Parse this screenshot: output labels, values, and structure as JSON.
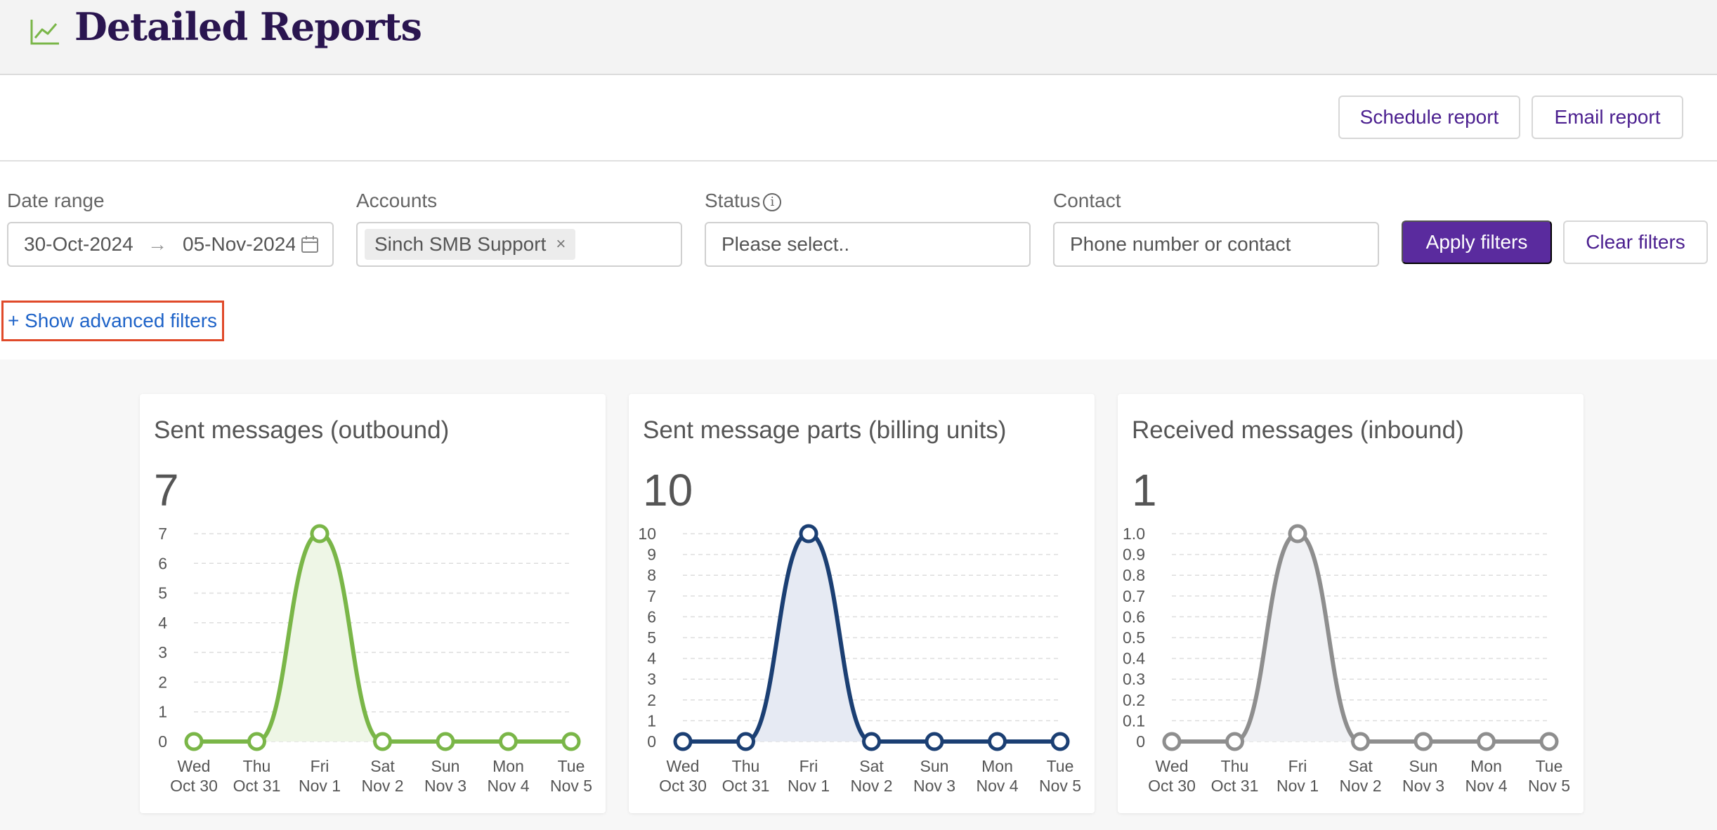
{
  "header": {
    "title": "Detailed Reports",
    "icon": "line-chart-icon",
    "accent": "#7ab648",
    "title_color": "#2a1550"
  },
  "toolbar": {
    "schedule_label": "Schedule report",
    "email_label": "Email report"
  },
  "filters": {
    "date_range": {
      "label": "Date range",
      "start": "30-Oct-2024",
      "end": "05-Nov-2024",
      "separator": "→"
    },
    "accounts": {
      "label": "Accounts",
      "tag": "Sinch SMB Support"
    },
    "status": {
      "label": "Status",
      "placeholder": "Please select.."
    },
    "contact": {
      "label": "Contact",
      "placeholder": "Phone number or contact"
    },
    "apply_label": "Apply filters",
    "clear_label": "Clear filters",
    "advanced_label": "+ Show advanced filters"
  },
  "cards": [
    {
      "title": "Sent messages (outbound)",
      "total": "7",
      "color": "#7ab648",
      "fill": "#eef6e6",
      "chart_data": {
        "type": "area",
        "x": [
          "Wed Oct 30",
          "Thu Oct 31",
          "Fri Nov 1",
          "Sat Nov 2",
          "Sun Nov 3",
          "Mon Nov 4",
          "Tue Nov 5"
        ],
        "x_lines": [
          [
            "Wed",
            "Oct 30"
          ],
          [
            "Thu",
            "Oct 31"
          ],
          [
            "Fri",
            "Nov 1"
          ],
          [
            "Sat",
            "Nov 2"
          ],
          [
            "Sun",
            "Nov 3"
          ],
          [
            "Mon",
            "Nov 4"
          ],
          [
            "Tue",
            "Nov 5"
          ]
        ],
        "values": [
          0,
          0,
          7,
          0,
          0,
          0,
          0
        ],
        "ylim": [
          0,
          7
        ],
        "yticks": [
          "0",
          "1",
          "2",
          "3",
          "4",
          "5",
          "6",
          "7"
        ],
        "grid": true
      }
    },
    {
      "title": "Sent message parts (billing units)",
      "total": "10",
      "color": "#1b3f73",
      "fill": "#e6eaf3",
      "chart_data": {
        "type": "area",
        "x": [
          "Wed Oct 30",
          "Thu Oct 31",
          "Fri Nov 1",
          "Sat Nov 2",
          "Sun Nov 3",
          "Mon Nov 4",
          "Tue Nov 5"
        ],
        "x_lines": [
          [
            "Wed",
            "Oct 30"
          ],
          [
            "Thu",
            "Oct 31"
          ],
          [
            "Fri",
            "Nov 1"
          ],
          [
            "Sat",
            "Nov 2"
          ],
          [
            "Sun",
            "Nov 3"
          ],
          [
            "Mon",
            "Nov 4"
          ],
          [
            "Tue",
            "Nov 5"
          ]
        ],
        "values": [
          0,
          0,
          10,
          0,
          0,
          0,
          0
        ],
        "ylim": [
          0,
          10
        ],
        "yticks": [
          "0",
          "1",
          "2",
          "3",
          "4",
          "5",
          "6",
          "7",
          "8",
          "9",
          "10"
        ],
        "grid": true
      }
    },
    {
      "title": "Received messages (inbound)",
      "total": "1",
      "color": "#8e8e8e",
      "fill": "#f0f1f4",
      "chart_data": {
        "type": "area",
        "x": [
          "Wed Oct 30",
          "Thu Oct 31",
          "Fri Nov 1",
          "Sat Nov 2",
          "Sun Nov 3",
          "Mon Nov 4",
          "Tue Nov 5"
        ],
        "x_lines": [
          [
            "Wed",
            "Oct 30"
          ],
          [
            "Thu",
            "Oct 31"
          ],
          [
            "Fri",
            "Nov 1"
          ],
          [
            "Sat",
            "Nov 2"
          ],
          [
            "Sun",
            "Nov 3"
          ],
          [
            "Mon",
            "Nov 4"
          ],
          [
            "Tue",
            "Nov 5"
          ]
        ],
        "values": [
          0,
          0,
          1,
          0,
          0,
          0,
          0
        ],
        "ylim": [
          0,
          1
        ],
        "yticks": [
          "0",
          "0.1",
          "0.2",
          "0.3",
          "0.4",
          "0.5",
          "0.6",
          "0.7",
          "0.8",
          "0.9",
          "1.0"
        ],
        "grid": true
      }
    }
  ]
}
